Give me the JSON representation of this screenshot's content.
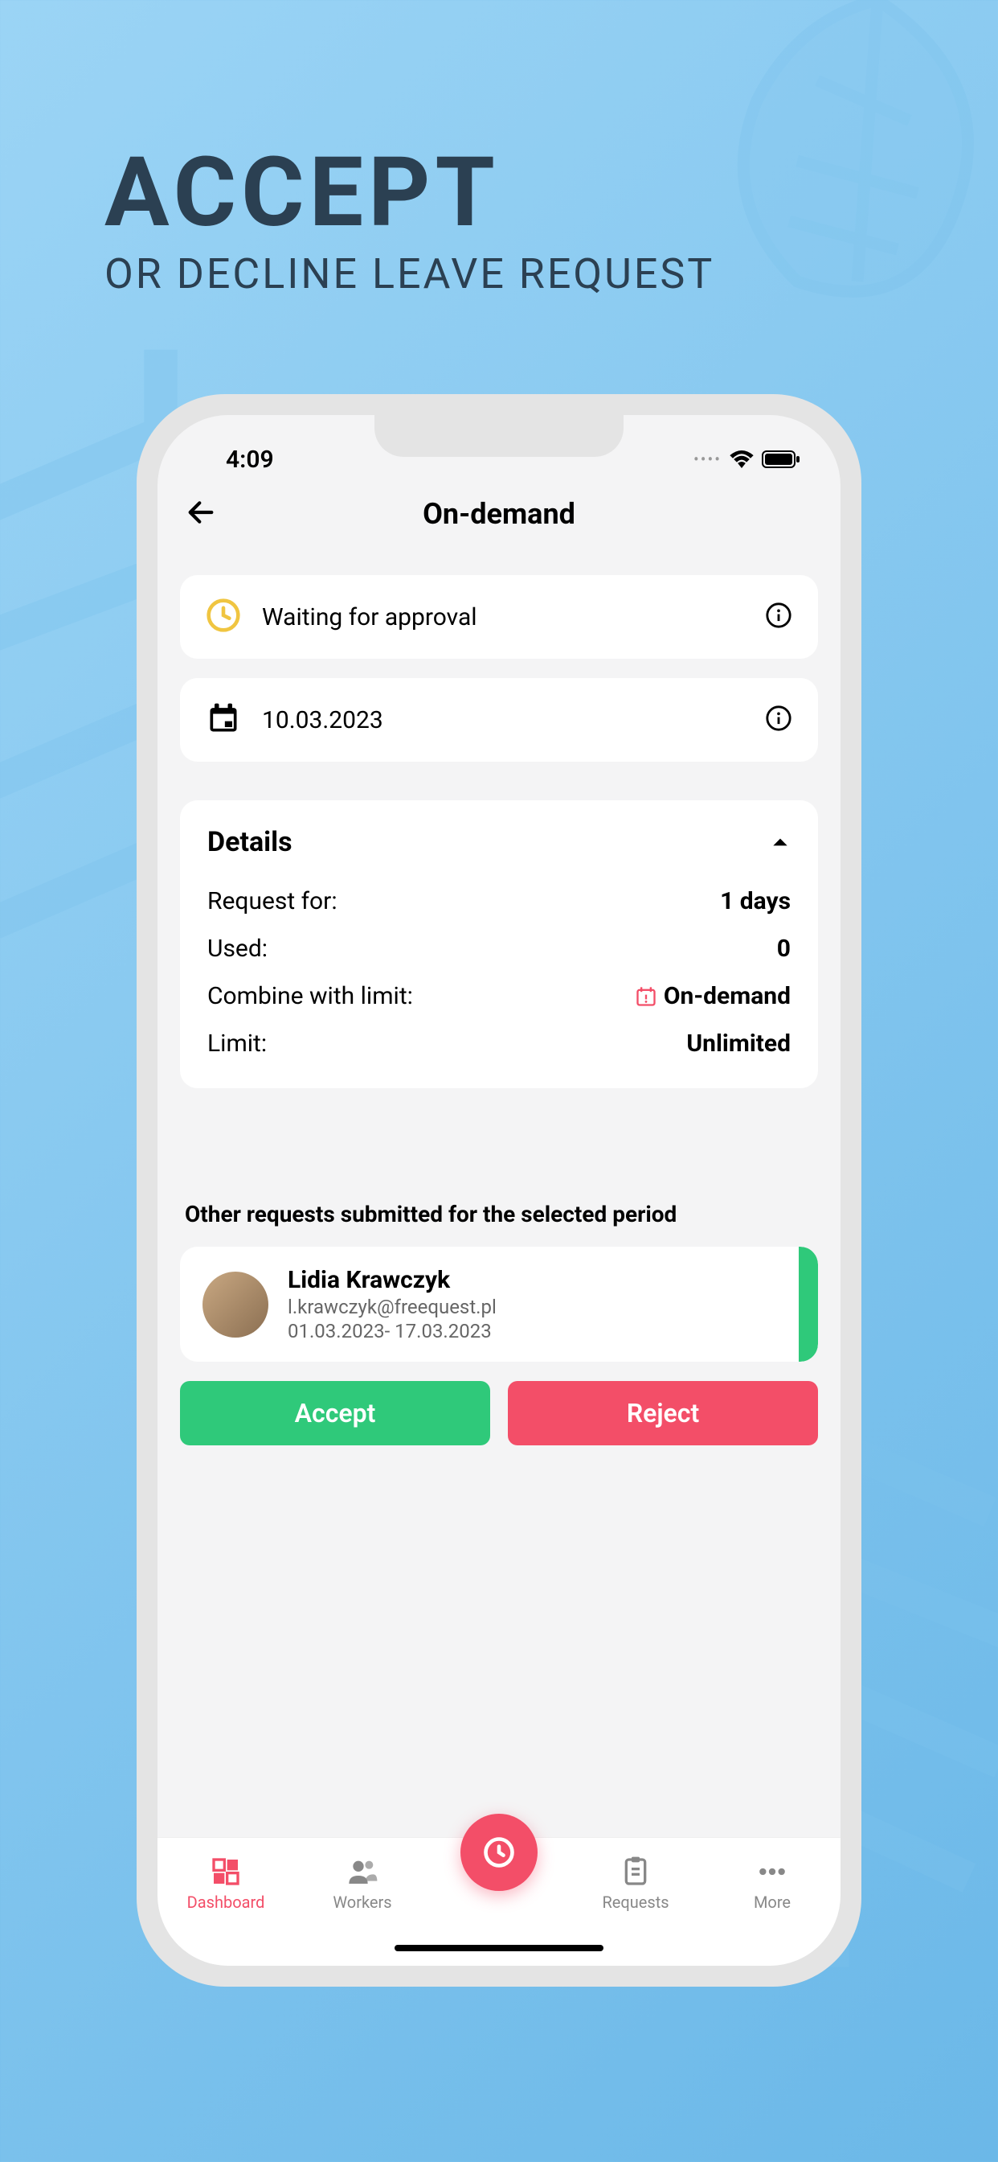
{
  "banner": {
    "title": "ACCEPT",
    "subtitle": "OR DECLINE LEAVE REQUEST"
  },
  "status": {
    "time": "4:09"
  },
  "header": {
    "title": "On-demand"
  },
  "status_card": {
    "text": "Waiting for approval"
  },
  "date_card": {
    "text": "10.03.2023"
  },
  "details": {
    "title": "Details",
    "rows": [
      {
        "label": "Request for:",
        "value": "1 days"
      },
      {
        "label": "Used:",
        "value": "0"
      },
      {
        "label": "Combine with limit:",
        "value": "On-demand"
      },
      {
        "label": "Limit:",
        "value": "Unlimited"
      }
    ]
  },
  "other_requests": {
    "heading": "Other requests submitted for the selected period",
    "person": {
      "name": "Lidia Krawczyk",
      "email": "l.krawczyk@freequest.pl",
      "dates": "01.03.2023- 17.03.2023"
    }
  },
  "actions": {
    "accept": "Accept",
    "reject": "Reject"
  },
  "nav": {
    "items": [
      {
        "label": "Dashboard"
      },
      {
        "label": "Workers"
      },
      {
        "label": "Requests"
      },
      {
        "label": "More"
      }
    ]
  },
  "colors": {
    "accent": "#f34e68",
    "success": "#2fc97a",
    "warning": "#f0c541"
  }
}
